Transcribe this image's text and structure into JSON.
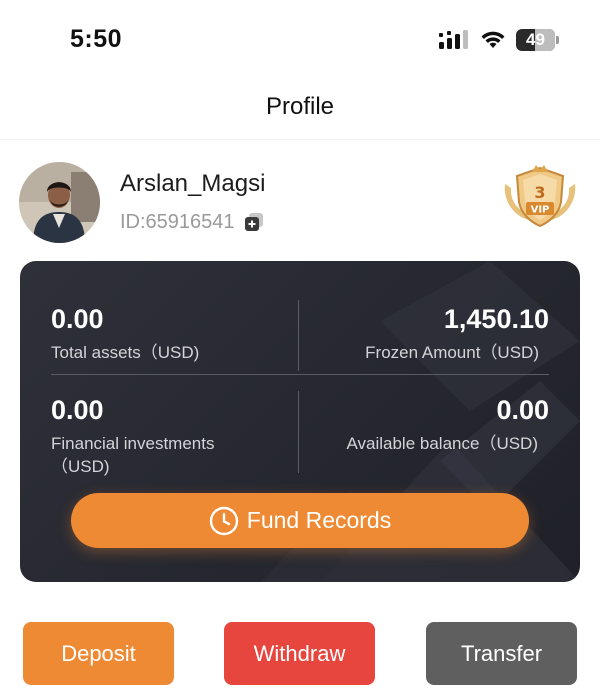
{
  "status_bar": {
    "time": "5:50",
    "battery_level": "49",
    "icons": [
      "signal-icon",
      "wifi-icon",
      "battery-icon"
    ]
  },
  "header": {
    "title": "Profile"
  },
  "profile": {
    "username": "Arslan_Magsi",
    "user_id": "ID:65916541",
    "vip_level": "3",
    "vip_text": "VIP"
  },
  "assets": {
    "total_assets": {
      "amount": "0.00",
      "label": "Total assets（USD)"
    },
    "frozen_amount": {
      "amount": "1,450.10",
      "label": "Frozen Amount（USD)"
    },
    "financial_investments": {
      "amount": "0.00",
      "label": "Financial investments（USD)"
    },
    "available_balance": {
      "amount": "0.00",
      "label": "Available balance（USD)"
    },
    "fund_records_label": "Fund Records"
  },
  "actions": {
    "deposit_label": "Deposit",
    "withdraw_label": "Withdraw",
    "transfer_label": "Transfer"
  },
  "colors": {
    "accent_orange": "#ef8a34",
    "withdraw_red": "#e6463e",
    "transfer_gray": "#5f5f5f",
    "card_dark": "#2a2b33"
  }
}
